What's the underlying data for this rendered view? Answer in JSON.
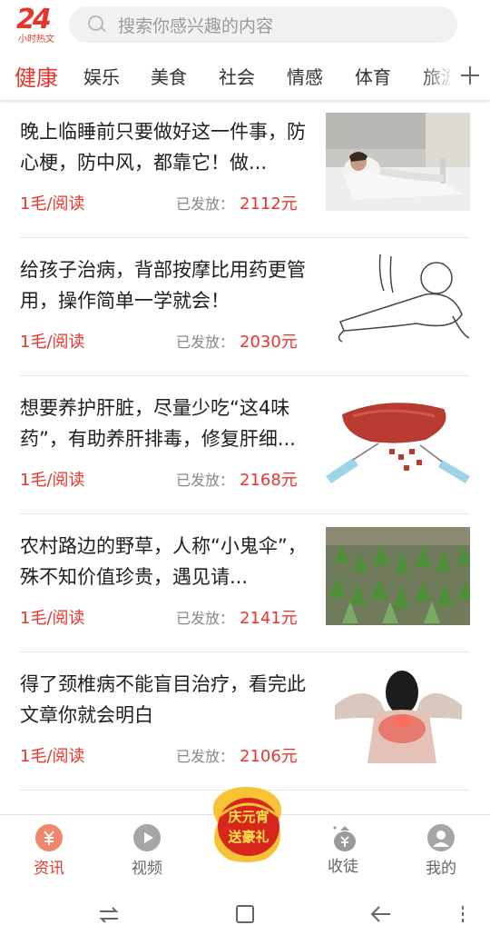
{
  "app": {
    "logo_main": "24",
    "logo_sub": "小时热文"
  },
  "search": {
    "placeholder": "搜索你感兴趣的内容"
  },
  "tabs": [
    {
      "label": "健康",
      "active": true
    },
    {
      "label": "娱乐"
    },
    {
      "label": "美食"
    },
    {
      "label": "社会"
    },
    {
      "label": "情感"
    },
    {
      "label": "体育"
    },
    {
      "label": "旅游"
    }
  ],
  "tabs_more_icon": "plus-icon",
  "feed": [
    {
      "title": "晚上临睡前只要做好这一件事，防心梗，防中风，都靠它！做...",
      "rate": "1毛/阅读",
      "paid_label": "已发放：",
      "paid_amount": "2112元",
      "image": "woman-resting-in-bed"
    },
    {
      "title": "给孩子治病，背部按摩比用药更管用，操作简单一学就会！",
      "rate": "1毛/阅读",
      "paid_label": "已发放：",
      "paid_amount": "2030元",
      "image": "baby-back-massage-sketch"
    },
    {
      "title": "想要养护肝脏，尽量少吃“这4味药”，有助养肝排毒，修复肝细...",
      "rate": "1毛/阅读",
      "paid_label": "已发放：",
      "paid_amount": "2168元",
      "image": "liver-puzzle-illustration"
    },
    {
      "title": "农村路边的野草，人称“小鬼伞”，殊不知价值珍贵，遇见请...",
      "rate": "1毛/阅读",
      "paid_label": "已发放：",
      "paid_amount": "2141元",
      "image": "green-wild-plants"
    },
    {
      "title": "得了颈椎病不能盲目治疗，看完此文章你就会明白",
      "rate": "1毛/阅读",
      "paid_label": "已发放：",
      "paid_amount": "2106元",
      "image": "neck-pain-woman"
    }
  ],
  "bottom_nav": [
    {
      "label": "资讯",
      "icon": "yuan-coin-icon",
      "active": true
    },
    {
      "label": "视频",
      "icon": "play-icon"
    },
    {
      "label": "收徒",
      "icon": "money-bag-icon"
    },
    {
      "label": "我的",
      "icon": "user-icon"
    }
  ],
  "promo": {
    "line1": "庆元宵",
    "line2": "送豪礼"
  },
  "colors": {
    "accent": "#e8352b",
    "text": "#1f1f1f",
    "muted": "#888888",
    "divider": "#e6e6e6"
  }
}
